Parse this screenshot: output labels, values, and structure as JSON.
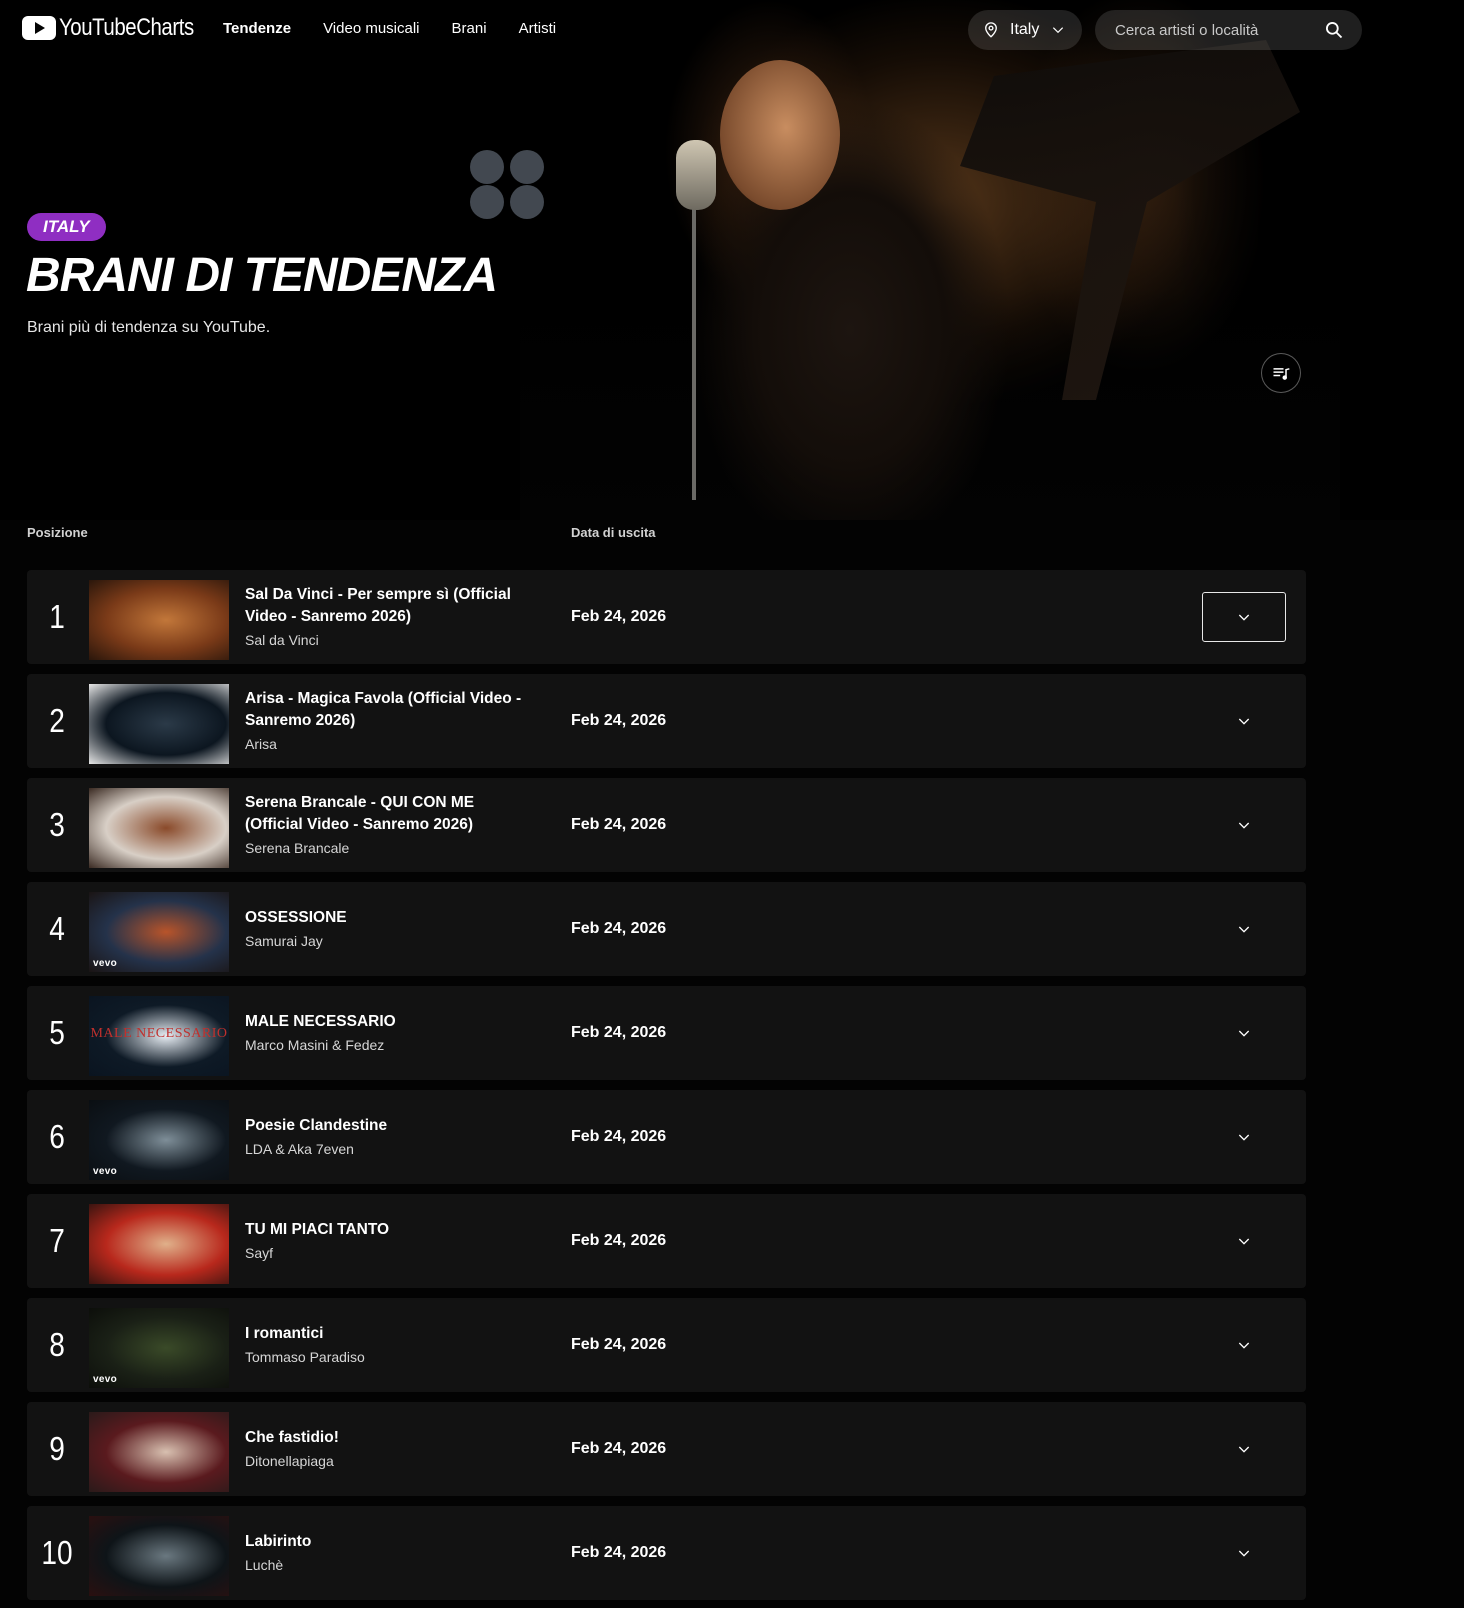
{
  "app": {
    "logo_youtube": "YouTube",
    "logo_charts": "Charts"
  },
  "nav": {
    "items": [
      {
        "label": "Tendenze",
        "active": true
      },
      {
        "label": "Video musicali",
        "active": false
      },
      {
        "label": "Brani",
        "active": false
      },
      {
        "label": "Artisti",
        "active": false
      }
    ]
  },
  "country": {
    "selected": "Italy"
  },
  "search": {
    "placeholder": "Cerca artisti o località",
    "value": ""
  },
  "hero": {
    "badge": "ITALY",
    "title": "BRANI DI TENDENZA",
    "subtitle": "Brani più di tendenza su YouTube."
  },
  "table": {
    "col_position": "Posizione",
    "col_release": "Data di uscita",
    "rows": [
      {
        "rank": "1",
        "title": "Sal Da Vinci - Per sempre sì (Official Video - Sanremo 2026)",
        "artist": "Sal da Vinci",
        "date": "Feb 24, 2026",
        "vevo": "",
        "thumb_colors": [
          "#7a3a18",
          "#c2773a",
          "#2a160b"
        ]
      },
      {
        "rank": "2",
        "title": "Arisa - Magica Favola (Official Video - Sanremo 2026)",
        "artist": "Arisa",
        "date": "Feb 24, 2026",
        "vevo": "",
        "thumb_colors": [
          "#0c1620",
          "#2b3a48",
          "#e8e8e8"
        ]
      },
      {
        "rank": "3",
        "title": "Serena Brancale - QUI CON ME (Official Video - Sanremo 2026)",
        "artist": "Serena Brancale",
        "date": "Feb 24, 2026",
        "vevo": "",
        "thumb_colors": [
          "#d8cfc6",
          "#8a4a2a",
          "#3a2a22"
        ]
      },
      {
        "rank": "4",
        "title": "OSSESSIONE",
        "artist": "Samurai Jay",
        "date": "Feb 24, 2026",
        "vevo": "vevo",
        "thumb_colors": [
          "#24324a",
          "#b8542a",
          "#1a1414"
        ]
      },
      {
        "rank": "5",
        "title": "MALE NECESSARIO",
        "artist": "Marco Masini & Fedez",
        "date": "Feb 24, 2026",
        "vevo": "",
        "thumb_text": "MALE NECESSARIO",
        "thumb_colors": [
          "#0e1a26",
          "#e8eef4",
          "#0a1420"
        ]
      },
      {
        "rank": "6",
        "title": "Poesie Clandestine",
        "artist": "LDA & Aka 7even",
        "date": "Feb 24, 2026",
        "vevo": "vevo",
        "thumb_colors": [
          "#101820",
          "#7e8e98",
          "#0a0e12"
        ]
      },
      {
        "rank": "7",
        "title": "TU MI PIACI TANTO",
        "artist": "Sayf",
        "date": "Feb 24, 2026",
        "vevo": "",
        "thumb_colors": [
          "#b8281c",
          "#e0b08a",
          "#3a1410"
        ]
      },
      {
        "rank": "8",
        "title": "I romantici",
        "artist": "Tommaso Paradiso",
        "date": "Feb 24, 2026",
        "vevo": "vevo",
        "thumb_colors": [
          "#1a2016",
          "#3a4a28",
          "#0c0e0a"
        ]
      },
      {
        "rank": "9",
        "title": "Che fastidio!",
        "artist": "Ditonellapiaga",
        "date": "Feb 24, 2026",
        "vevo": "",
        "thumb_colors": [
          "#5a1a1e",
          "#d8c0b0",
          "#2a1a1a"
        ]
      },
      {
        "rank": "10",
        "title": "Labirinto",
        "artist": "Luchè",
        "date": "Feb 24, 2026",
        "vevo": "",
        "thumb_colors": [
          "#0e1418",
          "#6a7880",
          "#2a1010"
        ]
      }
    ]
  },
  "colors": {
    "badge": "#8f2ec2",
    "row_bg": "#121212",
    "page_bg": "#030303"
  },
  "icons": {
    "logo": "youtube-play-icon",
    "country": "location-pin-icon",
    "dropdown": "chevron-down-icon",
    "search": "search-icon",
    "playlist": "playlist-music-icon",
    "row_expand": "chevron-down-icon"
  }
}
